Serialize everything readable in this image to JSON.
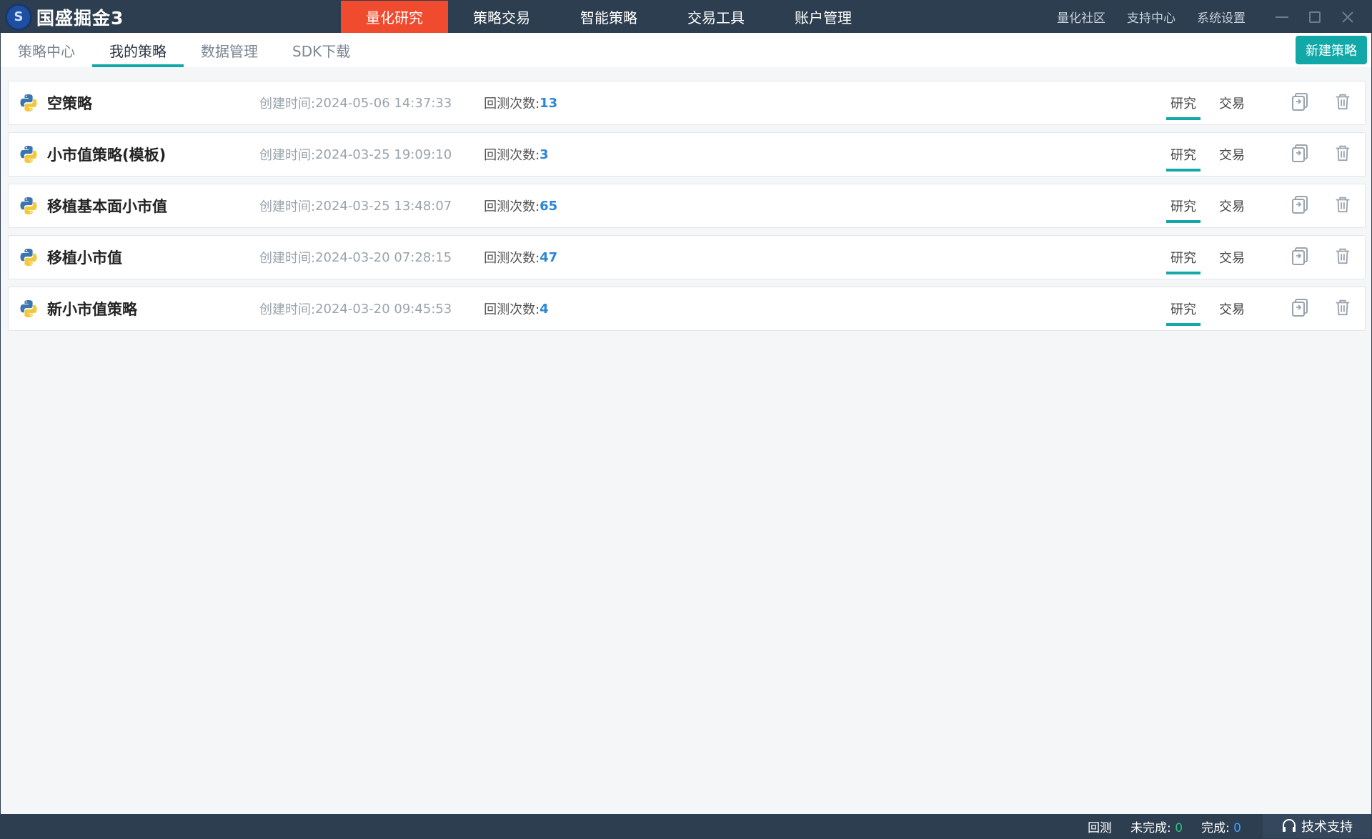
{
  "app": {
    "title": "国盛掘金3"
  },
  "colors": {
    "titlebar": "#2d3e50",
    "active_nav": "#f04b2e",
    "accent": "#12a8a8",
    "count_value": "#2a86d8"
  },
  "main_nav": [
    {
      "label": "量化研究",
      "active": true
    },
    {
      "label": "策略交易"
    },
    {
      "label": "智能策略"
    },
    {
      "label": "交易工具"
    },
    {
      "label": "账户管理"
    }
  ],
  "right_nav": [
    "量化社区",
    "支持中心",
    "系统设置"
  ],
  "sub_tabs": [
    {
      "label": "策略中心"
    },
    {
      "label": "我的策略",
      "active": true
    },
    {
      "label": "数据管理"
    },
    {
      "label": "SDK下载"
    }
  ],
  "new_strategy_button": "新建策略",
  "strategy_list": {
    "created_label": "创建时间:",
    "backtest_label": "回测次数:",
    "research_label": "研究",
    "trade_label": "交易",
    "items": [
      {
        "name": "空策略",
        "created": "2024-05-06 14:37:33",
        "backtests": "13",
        "icon": "python-icon"
      },
      {
        "name": "小市值策略(模板)",
        "created": "2024-03-25 19:09:10",
        "backtests": "3",
        "icon": "python-icon"
      },
      {
        "name": "移植基本面小市值",
        "created": "2024-03-25 13:48:07",
        "backtests": "65",
        "icon": "python-icon"
      },
      {
        "name": "移植小市值",
        "created": "2024-03-20 07:28:15",
        "backtests": "47",
        "icon": "python-icon"
      },
      {
        "name": "新小市值策略",
        "created": "2024-03-20 09:45:53",
        "backtests": "4",
        "icon": "python-icon"
      }
    ]
  },
  "status_bar": {
    "backtest": "回测",
    "unfinished_label": "未完成:",
    "unfinished_value": "0",
    "finished_label": "完成:",
    "finished_value": "0",
    "support": "技术支持"
  }
}
